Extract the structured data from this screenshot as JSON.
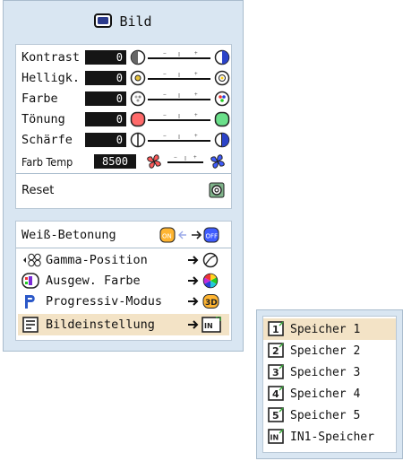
{
  "title": "Bild",
  "adjustments": [
    {
      "label": "Kontrast",
      "value": "0",
      "icon": "contrast-icon"
    },
    {
      "label": "Helligk.",
      "value": "0",
      "icon": "brightness-icon"
    },
    {
      "label": "Farbe",
      "value": "0",
      "icon": "color-icon"
    },
    {
      "label": "Tönung",
      "value": "0",
      "icon": "tint-icon"
    },
    {
      "label": "Schärfe",
      "value": "0",
      "icon": "sharpness-icon"
    }
  ],
  "color_temp": {
    "label": "Farb Temp",
    "value": "8500",
    "icon": "fan-icon"
  },
  "reset": {
    "label": "Reset",
    "icon": "reset-icon"
  },
  "options": [
    {
      "label": "Weiß-Betonung",
      "icon": "white-emphasis-icon"
    },
    {
      "label": "Gamma-Position",
      "icon": "gamma-icon"
    },
    {
      "label": "Ausgew. Farbe",
      "icon": "selected-color-icon"
    },
    {
      "label": "Progressiv-Modus",
      "icon": "progressive-icon"
    },
    {
      "label": "Bildeinstellung",
      "icon": "picture-setting-icon",
      "selected": true
    }
  ],
  "submenu": [
    {
      "label": "Speicher 1",
      "badge": "1",
      "selected": true
    },
    {
      "label": "Speicher 2",
      "badge": "2"
    },
    {
      "label": "Speicher 3",
      "badge": "3"
    },
    {
      "label": "Speicher 4",
      "badge": "4"
    },
    {
      "label": "Speicher 5",
      "badge": "5"
    },
    {
      "label": "IN1-Speicher",
      "badge": "IN"
    }
  ],
  "colors": {
    "menu_bg": "#d9e6f2",
    "highlight": "#f3e3c6",
    "value_bg": "#151515"
  }
}
